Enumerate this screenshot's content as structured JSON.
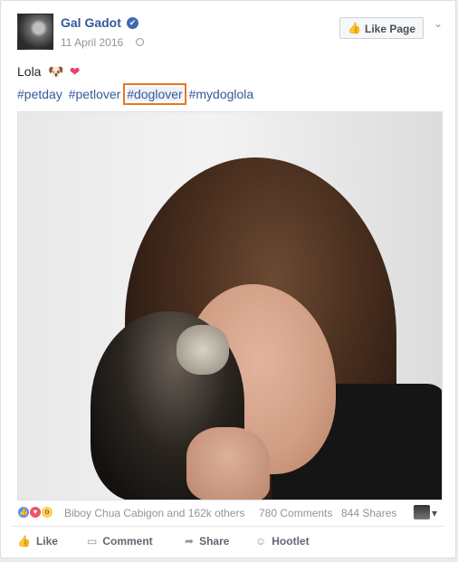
{
  "post": {
    "author": "Gal Gadot",
    "date": "11 April 2016",
    "verified_icon": "✔",
    "privacy_icon": "globe-icon",
    "like_page_label": "Like Page",
    "like_page_icon": "👍",
    "more_icon": "⌄",
    "caption_text": "Lola",
    "caption_emojis": [
      "🐶",
      "❤"
    ],
    "hashtags": [
      "#petday",
      "#petlover",
      "#doglover",
      "#mydoglola"
    ],
    "highlighted_hashtag_index": 2,
    "highlight_color": "#e8761b"
  },
  "reactions": {
    "icons": [
      "like",
      "love",
      "wow"
    ],
    "summary": "Biboy Chua Cabigon and 162k others",
    "comments": "780 Comments",
    "shares": "844 Shares"
  },
  "actions": [
    {
      "label": "Like",
      "icon": "like-icon",
      "glyph": "👍"
    },
    {
      "label": "Comment",
      "icon": "comment-icon",
      "glyph": "▭"
    },
    {
      "label": "Share",
      "icon": "share-icon",
      "glyph": "➦"
    },
    {
      "label": "Hootlet",
      "icon": "hootlet-icon",
      "glyph": "☺"
    }
  ],
  "colors": {
    "link": "#365899",
    "text": "#1d2129",
    "muted": "#90949c",
    "background": "#e9ebee"
  }
}
